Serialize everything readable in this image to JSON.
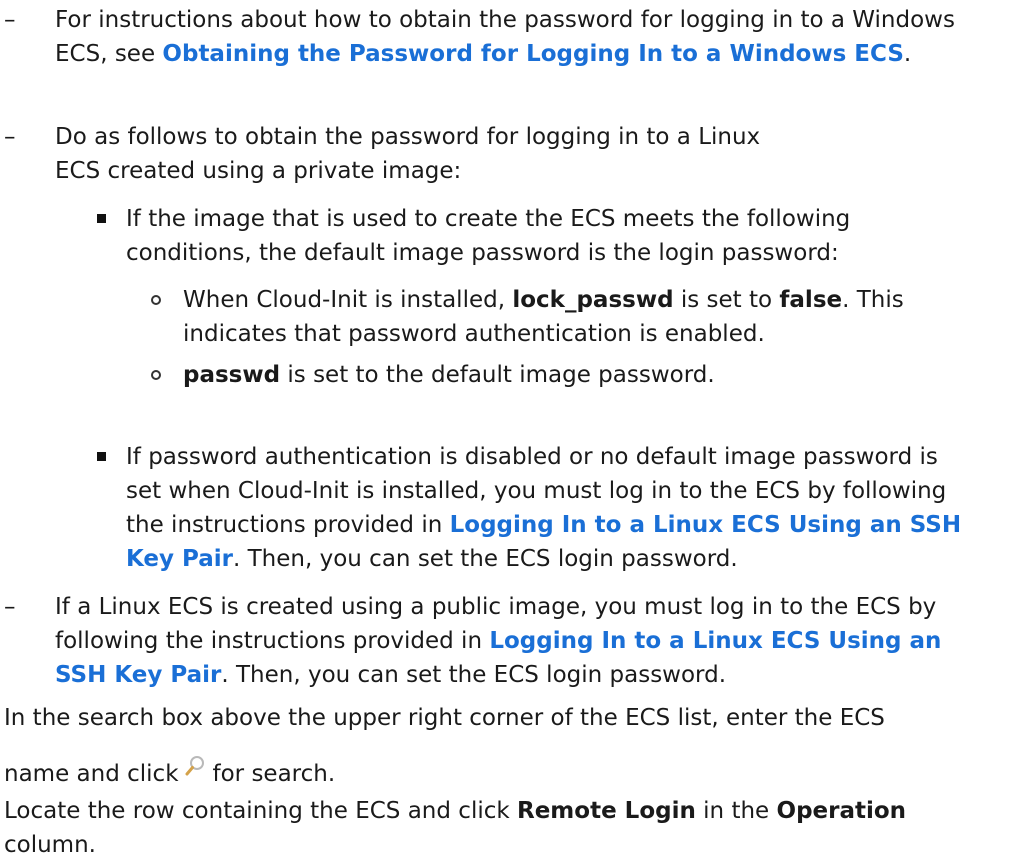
{
  "list": {
    "dash": "–",
    "item1": {
      "pre": "For instructions about how to obtain the password for logging in to a Windows ECS, see ",
      "link": "Obtaining the Password for Logging In to a Windows ECS",
      "post": "."
    },
    "item2": {
      "text": "Do as follows to obtain the password for logging in to a Linux ECS created using a private image:",
      "sub1": {
        "text": "If the image that is used to create the ECS meets the following conditions, the default image password is the login password:",
        "cond1": {
          "pre": "When Cloud-Init is installed, ",
          "bold1": "lock_passwd",
          "mid": " is set to ",
          "bold2": "false",
          "post": ". This indicates that password authentication is enabled."
        },
        "cond2": {
          "bold": "passwd",
          "post": " is set to the default image password."
        }
      },
      "sub2": {
        "pre": "If password authentication is disabled or no default image password is set when Cloud-Init is installed, you must log in to the ECS by following the instructions provided in ",
        "link": "Logging In to a Linux ECS Using an SSH Key Pair",
        "post": ". Then, you can set the ECS login password."
      }
    },
    "item3": {
      "pre": "If a Linux ECS is created using a public image, you must log in to the ECS by following the instructions provided in ",
      "link": "Logging In to a Linux ECS Using an SSH Key Pair",
      "post": ". Then, you can set the ECS login password."
    }
  },
  "steps": {
    "search": {
      "line1": "In the search box above the upper right corner of the ECS list, enter the ECS",
      "pre2": "name and click",
      "icon": "search-icon",
      "post2": "for search."
    },
    "locate": {
      "pre": "Locate the row containing the ECS and click ",
      "bold1": "Remote Login",
      "mid": " in the ",
      "bold2": "Operation",
      "post": " column."
    }
  },
  "colors": {
    "link": "#1a6fd6",
    "text": "#1a1a1a"
  }
}
